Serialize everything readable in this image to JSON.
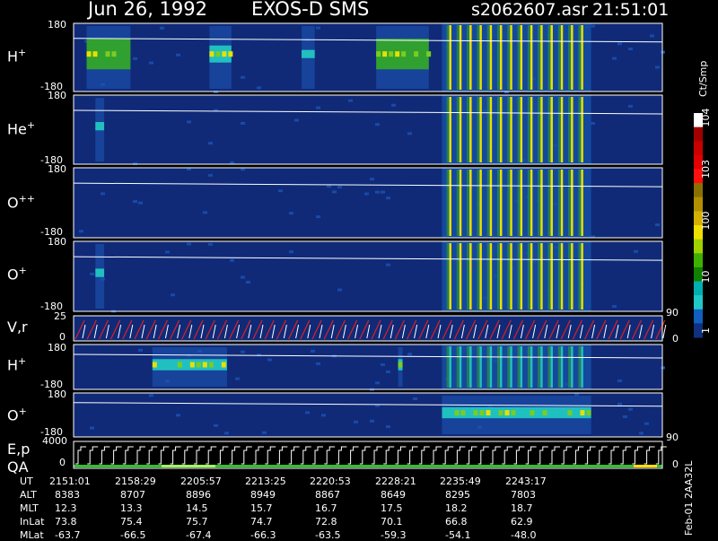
{
  "header": {
    "date": "Jun 26, 1992",
    "instrument": "EXOS-D SMS",
    "file": "s2062607.asr",
    "time": "21:51:01"
  },
  "panels": [
    {
      "id": "hplus_top",
      "label": "H",
      "sup": "+",
      "ymax": "180",
      "ymin": "-180"
    },
    {
      "id": "heplus",
      "label": "He",
      "sup": "+",
      "ymax": "180",
      "ymin": "-180"
    },
    {
      "id": "oplusplus",
      "label": "O",
      "sup": "++",
      "ymax": "180",
      "ymin": "-180"
    },
    {
      "id": "oplus_top",
      "label": "O",
      "sup": "+",
      "ymax": "180",
      "ymin": "-180"
    },
    {
      "id": "vr",
      "label": "V,r",
      "ymax": "25",
      "ymin": "0",
      "rmax": "90",
      "rmin": "0"
    },
    {
      "id": "hplus_low",
      "label": "H",
      "sup": "+",
      "ymax": "180",
      "ymin": "-180"
    },
    {
      "id": "oplus_low",
      "label": "O",
      "sup": "+",
      "ymax": "180",
      "ymin": "-180"
    },
    {
      "id": "ep",
      "label": "E,p",
      "label2": "QA",
      "ymax": "4000",
      "ymin": "0",
      "rmax": "90",
      "rmin": "0"
    }
  ],
  "colorbar": {
    "unit": "Ct/Smp",
    "labels": [
      {
        "text": "10",
        "sup": "4",
        "frac": 0.02
      },
      {
        "text": "10",
        "sup": "3",
        "frac": 0.25
      },
      {
        "text": "100",
        "frac": 0.48
      },
      {
        "text": "10",
        "frac": 0.73
      },
      {
        "text": "1",
        "frac": 0.97
      }
    ],
    "colors": [
      "#ffffff",
      "#a00000",
      "#c80000",
      "#e00000",
      "#ff1010",
      "#8a7000",
      "#b09000",
      "#d4b000",
      "#f0e000",
      "#a0d000",
      "#40b000",
      "#108000",
      "#00b0b0",
      "#20c8c8",
      "#1060c0",
      "#103080"
    ]
  },
  "footer": {
    "row_labels": [
      "UT",
      "ALT",
      "MLT",
      "InLat",
      "MLat"
    ],
    "columns": [
      [
        "2151:01",
        "8383",
        "12.3",
        "73.8",
        "-63.7"
      ],
      [
        "2158:29",
        "8707",
        "13.3",
        "75.4",
        "-66.5"
      ],
      [
        "2205:57",
        "8896",
        "14.5",
        "75.7",
        "-67.4"
      ],
      [
        "2213:25",
        "8949",
        "15.7",
        "74.7",
        "-66.3"
      ],
      [
        "2220:53",
        "8867",
        "16.7",
        "72.8",
        "-63.5"
      ],
      [
        "2228:21",
        "8649",
        "17.5",
        "70.1",
        "-59.3"
      ],
      [
        "2235:49",
        "8295",
        "18.2",
        "66.8",
        "-54.1"
      ],
      [
        "2243:17",
        "7803",
        "18.7",
        "62.9",
        "-48.0"
      ]
    ],
    "side_note": "Feb-01 2AA32L"
  },
  "chart_data": {
    "type": "heatmap",
    "x_axis": "UT",
    "x_ticks": [
      "2151:01",
      "2158:29",
      "2205:57",
      "2213:25",
      "2220:53",
      "2228:21",
      "2235:49",
      "2243:17"
    ],
    "color_scale": "log",
    "color_range": [
      1,
      10000
    ],
    "color_unit": "Ct/Smp",
    "series": [
      {
        "name": "H+",
        "ylim": [
          -180,
          180
        ],
        "enhancements": [
          {
            "t_start": "2152:30",
            "t_end": "2157:30",
            "intensity": "high"
          },
          {
            "t_start": "2206:30",
            "t_end": "2209:00",
            "intensity": "medium"
          },
          {
            "t_start": "2217:00",
            "t_end": "2218:30",
            "intensity": "low"
          },
          {
            "t_start": "2225:30",
            "t_end": "2231:30",
            "intensity": "high"
          },
          {
            "t_start": "2233:00",
            "t_end": "2250:00",
            "intensity": "high",
            "pattern": "periodic"
          }
        ]
      },
      {
        "name": "He+",
        "ylim": [
          -180,
          180
        ],
        "enhancements": [
          {
            "t_start": "2153:30",
            "t_end": "2154:30",
            "intensity": "low"
          },
          {
            "t_start": "2233:00",
            "t_end": "2250:00",
            "intensity": "high",
            "pattern": "periodic"
          }
        ]
      },
      {
        "name": "O++",
        "ylim": [
          -180,
          180
        ],
        "enhancements": [
          {
            "t_start": "2233:00",
            "t_end": "2250:00",
            "intensity": "high",
            "pattern": "periodic"
          }
        ]
      },
      {
        "name": "O+",
        "ylim": [
          -180,
          180
        ],
        "enhancements": [
          {
            "t_start": "2153:30",
            "t_end": "2154:30",
            "intensity": "low"
          },
          {
            "t_start": "2233:00",
            "t_end": "2250:00",
            "intensity": "high",
            "pattern": "periodic"
          }
        ]
      },
      {
        "name": "V,r",
        "ylim": [
          0,
          25
        ],
        "pattern": "sawtooth"
      },
      {
        "name": "H+ (low)",
        "ylim": [
          -180,
          180
        ],
        "enhancements": [
          {
            "t_start": "2160:00",
            "t_end": "2208:30",
            "intensity": "medium"
          },
          {
            "t_start": "2228:00",
            "t_end": "2228:30",
            "intensity": "medium"
          },
          {
            "t_start": "2233:00",
            "t_end": "2250:00",
            "intensity": "medium",
            "pattern": "periodic"
          }
        ]
      },
      {
        "name": "O+ (low)",
        "ylim": [
          -180,
          180
        ],
        "enhancements": [
          {
            "t_start": "2233:00",
            "t_end": "2250:00",
            "intensity": "medium"
          }
        ]
      },
      {
        "name": "E,p",
        "ylim": [
          0,
          4000
        ],
        "pattern": "staircase"
      }
    ]
  }
}
